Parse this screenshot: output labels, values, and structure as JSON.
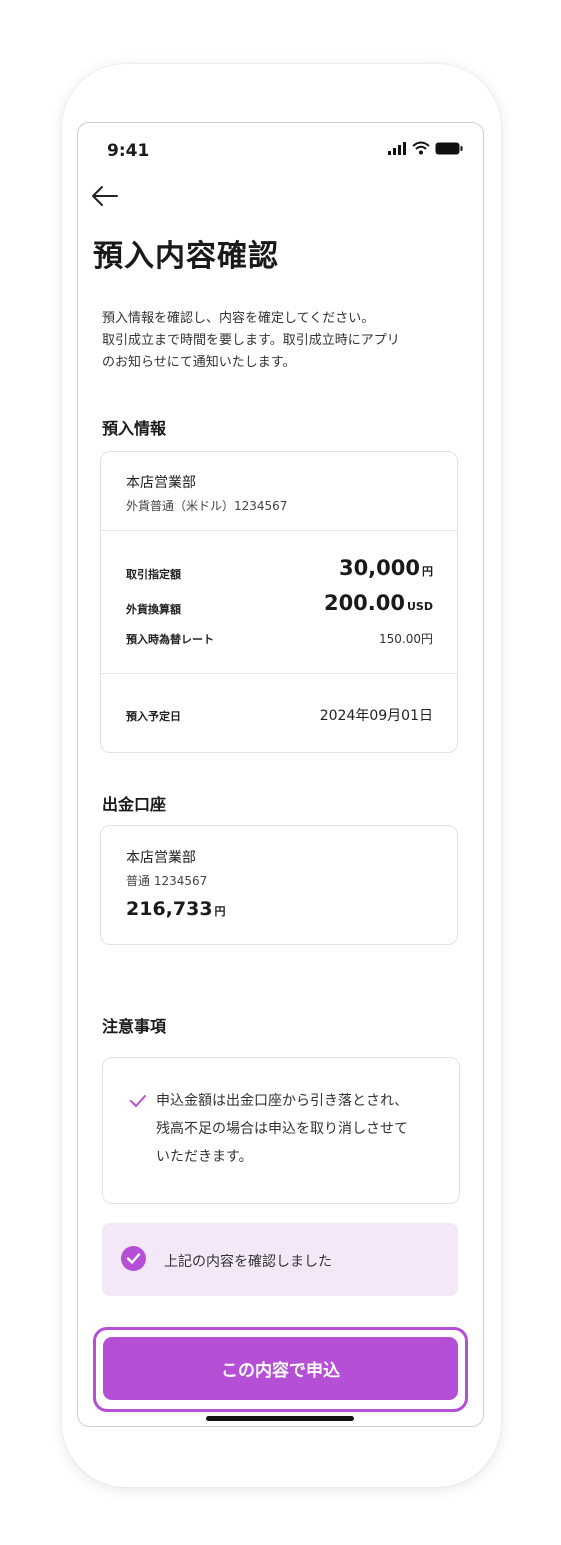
{
  "status_bar": {
    "time": "9:41"
  },
  "header": {
    "title": "預入内容確認"
  },
  "lead": {
    "lines": [
      "預入情報を確認し、内容を確定してください。",
      "取引成立まで時間を要します。取引成立時にアプリ",
      "のお知らせにて通知いたします。"
    ]
  },
  "deposit_info": {
    "section_title": "預入情報",
    "branch": "本店営業部",
    "account": "外貨普通（米ドル）1234567",
    "designated_label": "取引指定額",
    "designated_amount": "30,000",
    "designated_unit": "円",
    "converted_label": "外貨換算額",
    "converted_amount": "200.00",
    "converted_unit": "USD",
    "rate_label": "預入時為替レート",
    "rate_value": "150.00円",
    "date_label": "預入予定日",
    "date_value": "2024年09月01日"
  },
  "withdrawal": {
    "section_title": "出金口座",
    "branch": "本店営業部",
    "account": "普通 1234567",
    "balance": "216,733",
    "balance_unit": "円"
  },
  "notes": {
    "section_title": "注意事項",
    "lines": [
      "申込金額は出金口座から引き落とされ、",
      "残高不足の場合は申込を取り消しさせて",
      "いただきます。"
    ]
  },
  "confirm": {
    "label": "上記の内容を確認しました",
    "checked": true
  },
  "submit": {
    "label": "この内容で申込"
  },
  "colors": {
    "accent": "#b44fd6",
    "confirm_bg": "#f3e7f8"
  }
}
